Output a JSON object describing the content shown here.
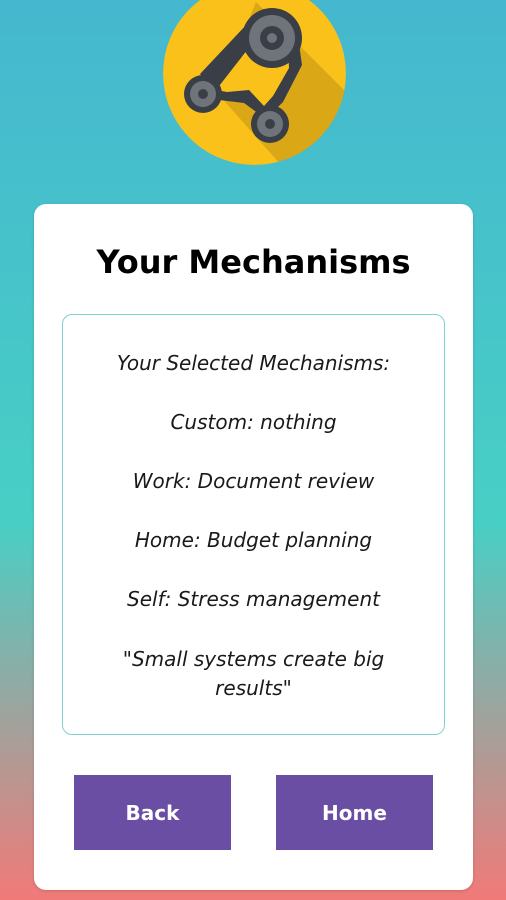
{
  "colors": {
    "background_top": "#45b7cf",
    "background_middle": "#48cfc5",
    "background_bottom": "#f17a78",
    "logo_circle": "#fbc11b",
    "card": "#ffffff",
    "box_border": "#7fd3cc",
    "button": "#6a4ea4"
  },
  "logo": {
    "icon": "belt-drive-gears-icon"
  },
  "card": {
    "title": "Your Mechanisms"
  },
  "selection": {
    "heading": "Your Selected Mechanisms:",
    "items": [
      "Custom: nothing",
      "Work: Document review",
      "Home: Budget planning",
      "Self: Stress management"
    ],
    "quote": "\"Small systems create big results\""
  },
  "buttons": {
    "back": "Back",
    "home": "Home"
  }
}
